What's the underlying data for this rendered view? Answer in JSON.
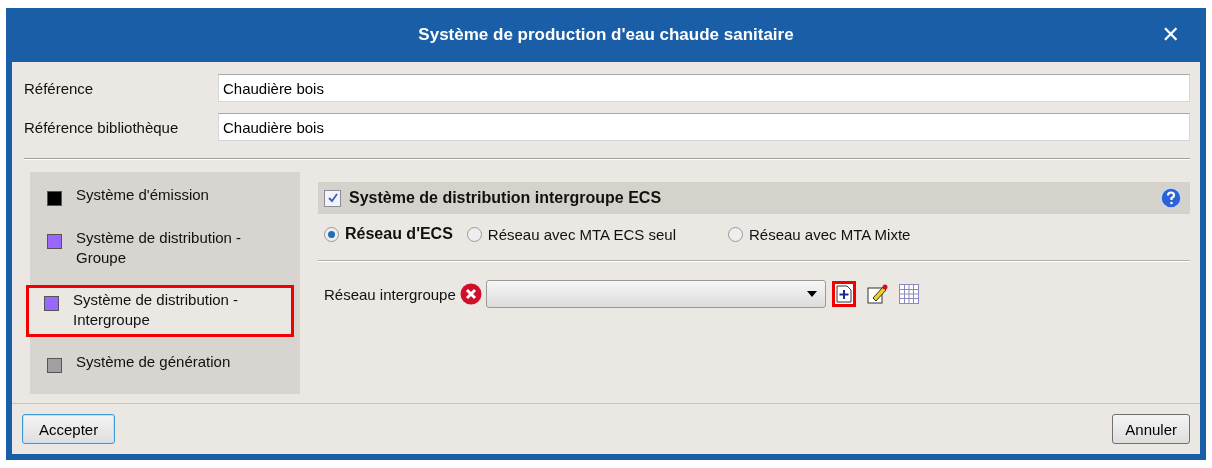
{
  "window": {
    "title": "Système de production d'eau chaude sanitaire",
    "close": "✕"
  },
  "fields": [
    {
      "label": "Référence",
      "value": "Chaudière bois"
    },
    {
      "label": "Référence bibliothèque",
      "value": "Chaudière bois"
    }
  ],
  "sidebar": {
    "items": [
      {
        "label": "Système d'émission",
        "color": "#000000",
        "selected": false
      },
      {
        "label": "Système de distribution - Groupe",
        "color": "#9966ff",
        "selected": false
      },
      {
        "label": "Système de distribution - Intergroupe",
        "color": "#9966ff",
        "selected": true
      },
      {
        "label": "Système de génération",
        "color": "#a0a0a0",
        "selected": false
      }
    ]
  },
  "section": {
    "title": "Système de distribution intergroupe ECS",
    "checked": true,
    "radios": [
      {
        "label": "Réseau d'ECS",
        "selected": true
      },
      {
        "label": "Réseau avec MTA ECS seul",
        "selected": false
      },
      {
        "label": "Réseau avec MTA Mixte",
        "selected": false
      }
    ],
    "network": {
      "label": "Réseau intergroupe",
      "error": true,
      "add_highlighted": true
    }
  },
  "buttons": [
    {
      "label": "Accepter",
      "kind": "default"
    },
    {
      "label": "Annuler",
      "kind": "normal"
    }
  ]
}
